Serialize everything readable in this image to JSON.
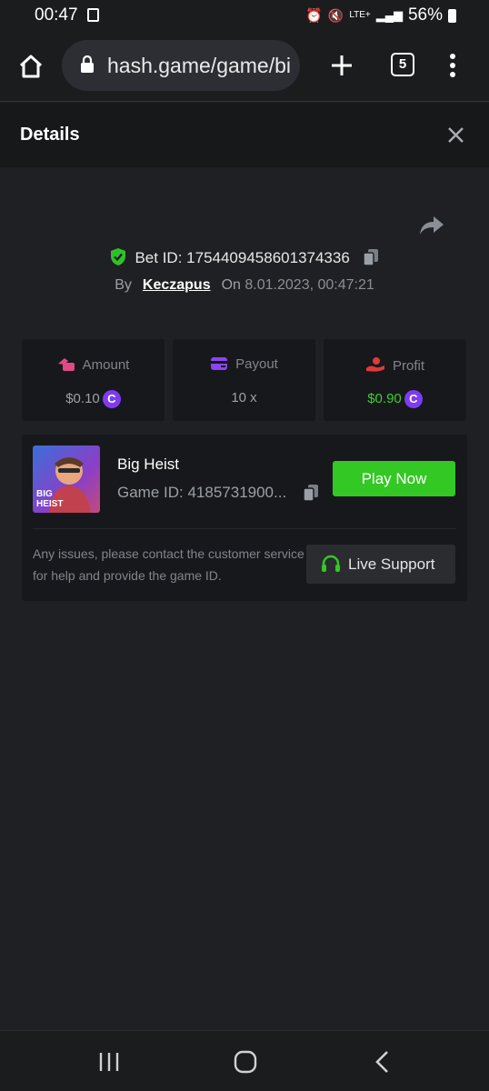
{
  "status_bar": {
    "time": "00:47",
    "battery": "56%",
    "network": "LTE+"
  },
  "browser": {
    "url": "hash.game/game/bi",
    "tab_count": "5"
  },
  "header": {
    "title": "Details"
  },
  "bet": {
    "bet_id_label": "Bet ID:",
    "bet_id": "1754409458601374336",
    "by_label": "By",
    "user": "Keczapus",
    "on_label": "On",
    "date": "8.01.2023, 00:47:21"
  },
  "stats": {
    "amount_label": "Amount",
    "amount_value": "$0.10",
    "payout_label": "Payout",
    "payout_value": "10 x",
    "profit_label": "Profit",
    "profit_value": "$0.90",
    "coin_symbol": "C"
  },
  "game": {
    "name": "Big Heist",
    "game_id": "Game ID: 4185731900...",
    "play_label": "Play Now",
    "thumb_text": "BIG HEIST",
    "issue_text": "Any issues, please contact the customer service for help and provide the game ID.",
    "support_label": "Live Support"
  },
  "colors": {
    "accent_green": "#33c824",
    "coin_purple": "#7d3cf2",
    "profit_green": "#3ccf2e",
    "amount_pink": "#e04a84",
    "payout_purple": "#8b45f0",
    "profit_red": "#e03a3a"
  },
  "icons": {
    "home": "home-icon",
    "lock": "lock-icon",
    "plus": "plus-icon",
    "menu": "more-vertical-icon",
    "close": "close-icon",
    "share": "share-icon",
    "shield": "shield-check-icon",
    "copy": "copy-icon",
    "headset": "headset-icon"
  }
}
